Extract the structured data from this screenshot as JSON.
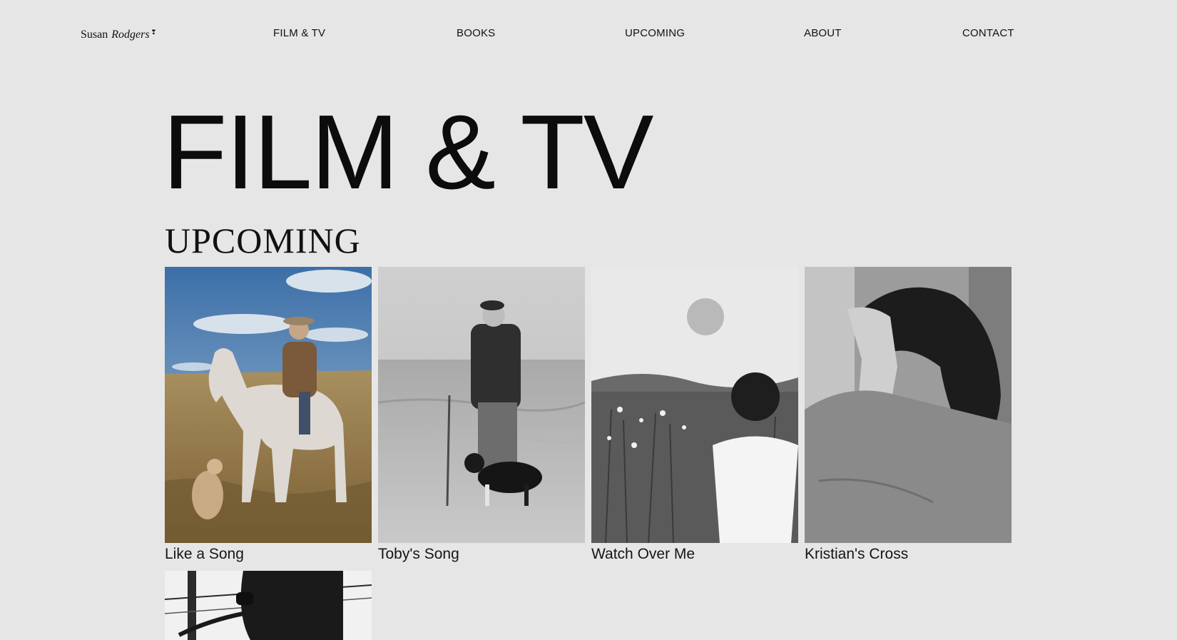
{
  "header": {
    "logo": {
      "first": "Susan",
      "last": "Rodgers",
      "mark": "❣"
    },
    "nav": [
      {
        "label": "FILM & TV"
      },
      {
        "label": "BOOKS"
      },
      {
        "label": "UPCOMING"
      },
      {
        "label": "ABOUT"
      },
      {
        "label": "CONTACT"
      }
    ]
  },
  "main": {
    "title": "FILM & TV",
    "section": {
      "heading": "UPCOMING",
      "items": [
        {
          "title": "Like a Song"
        },
        {
          "title": "Toby's Song"
        },
        {
          "title": "Watch Over Me"
        },
        {
          "title": "Kristian's Cross"
        }
      ]
    }
  },
  "colors": {
    "background": "#e6e6e6",
    "text": "#111111"
  }
}
